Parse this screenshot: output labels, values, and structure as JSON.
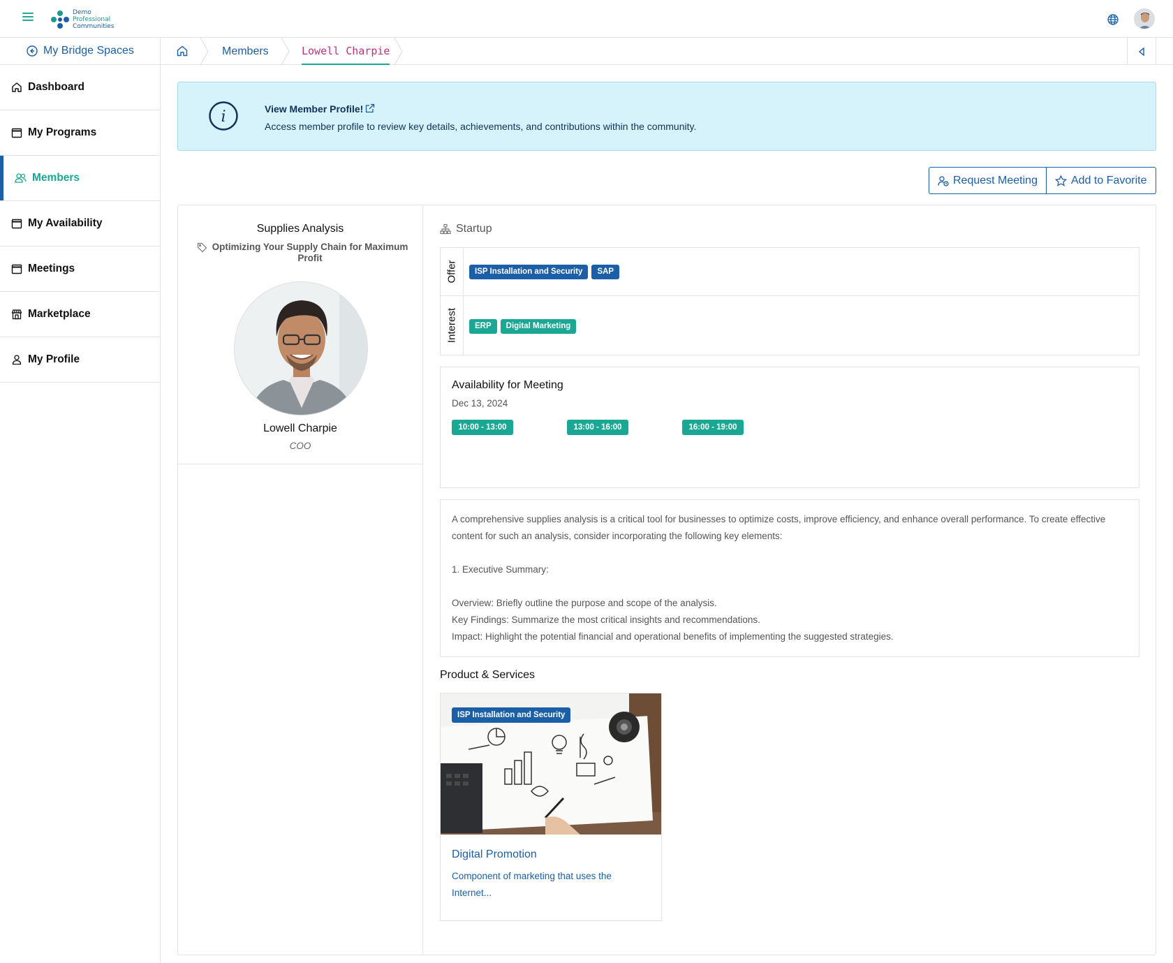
{
  "header": {
    "logo_lines": [
      "Demo",
      "Professional",
      "Communities"
    ]
  },
  "sidebar": {
    "spaces_link": "My Bridge Spaces",
    "items": [
      {
        "label": "Dashboard",
        "icon": "home-icon"
      },
      {
        "label": "My Programs",
        "icon": "calendar-icon"
      },
      {
        "label": "Members",
        "icon": "users-icon",
        "active": true
      },
      {
        "label": "My Availability",
        "icon": "calendar-icon"
      },
      {
        "label": "Meetings",
        "icon": "calendar-icon"
      },
      {
        "label": "Marketplace",
        "icon": "store-icon"
      },
      {
        "label": "My Profile",
        "icon": "user-icon"
      }
    ]
  },
  "breadcrumb": {
    "items": [
      "Members",
      "Lowell Charpie"
    ]
  },
  "banner": {
    "title": "View Member Profile!",
    "text": "Access member profile to review key details, achievements, and contributions within the community."
  },
  "actions": {
    "request_meeting": "Request Meeting",
    "add_favorite": "Add to Favorite"
  },
  "profile": {
    "company": "Supplies Analysis",
    "tagline": "Optimizing Your Supply Chain for Maximum Profit",
    "name": "Lowell Charpie",
    "role": "COO",
    "category": "Startup"
  },
  "tags": {
    "offer_label": "Offer",
    "offer": [
      "ISP Installation and Security",
      "SAP"
    ],
    "interest_label": "Interest",
    "interest": [
      "ERP",
      "Digital Marketing"
    ]
  },
  "availability": {
    "title": "Availability for Meeting",
    "date": "Dec 13, 2024",
    "slots": [
      "10:00 - 13:00",
      "13:00 - 16:00",
      "16:00 - 19:00"
    ]
  },
  "description": {
    "p1": "A comprehensive supplies analysis is a critical tool for businesses to optimize costs, improve efficiency, and enhance overall performance. To create effective content for such an analysis, consider incorporating the following key elements:",
    "p2": "1. Executive Summary:",
    "p3": "Overview: Briefly outline the purpose and scope of the analysis.",
    "p4": "Key Findings: Summarize the most critical insights and recommendations.",
    "p5": "Impact: Highlight the potential financial and operational benefits of implementing the suggested strategies."
  },
  "products": {
    "title": "Product & Services",
    "items": [
      {
        "tag": "ISP Installation and Security",
        "name": "Digital Promotion",
        "desc": "Component of marketing that uses the Internet..."
      }
    ]
  },
  "colors": {
    "primary": "#1a5fa8",
    "accent": "#1aa895",
    "banner_bg": "#d6f2fa",
    "current_crumb": "#c0317b"
  }
}
